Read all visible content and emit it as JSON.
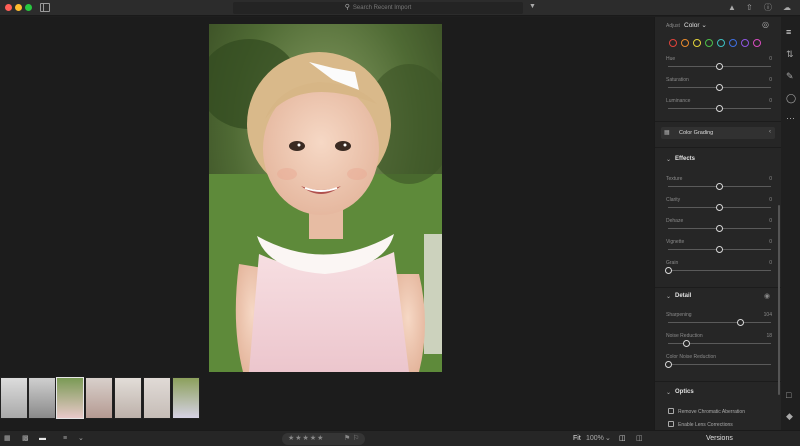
{
  "search": {
    "placeholder": "Search Recent Import"
  },
  "panel": {
    "adjust_label": "Adjust",
    "adjust_value": "Color",
    "color_dots": [
      "#e0433b",
      "#e88a2c",
      "#e3d33a",
      "#4cbf4a",
      "#3dbfc1",
      "#3f6fe0",
      "#8e55e0",
      "#d94bbf"
    ],
    "color_sliders": [
      {
        "label": "Hue",
        "value": "0",
        "level": 0.5
      },
      {
        "label": "Saturation",
        "value": "0",
        "level": 0.5
      },
      {
        "label": "Luminance",
        "value": "0",
        "level": 0.5
      }
    ],
    "color_grading": "Color Grading",
    "effects": {
      "title": "Effects",
      "sliders": [
        {
          "label": "Texture",
          "value": "0",
          "level": 0.5
        },
        {
          "label": "Clarity",
          "value": "0",
          "level": 0.5
        },
        {
          "label": "Dehaze",
          "value": "0",
          "level": 0.5
        },
        {
          "label": "Vignette",
          "value": "0",
          "level": 0.5
        },
        {
          "label": "Grain",
          "value": "0",
          "level": 0
        }
      ]
    },
    "detail": {
      "title": "Detail",
      "sliders": [
        {
          "label": "Sharpening",
          "value": "104",
          "level": 0.7
        },
        {
          "label": "Noise Reduction",
          "value": "18",
          "level": 0.18
        },
        {
          "label": "Color Noise Reduction",
          "value": "",
          "level": 0
        }
      ]
    },
    "optics": {
      "title": "Optics",
      "checks": [
        "Remove Chromatic Aberration",
        "Enable Lens Corrections"
      ]
    }
  },
  "bottombar": {
    "stars": "★★★★★",
    "fit": "Fit",
    "zoom": "100%",
    "versions": "Versions"
  }
}
